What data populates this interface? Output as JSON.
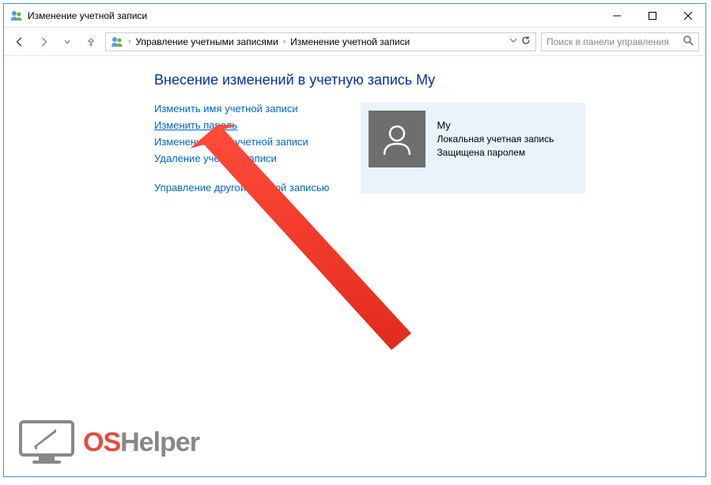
{
  "window": {
    "title": "Изменение учетной записи"
  },
  "breadcrumb": {
    "item1": "Управление учетными записями",
    "item2": "Изменение учетной записи"
  },
  "search": {
    "placeholder": "Поиск в панели управления"
  },
  "page": {
    "heading": "Внесение изменений в учетную запись My"
  },
  "links": {
    "rename": "Изменить имя учетной записи",
    "change_password": "Изменить пароль",
    "change_type": "Изменение типа учетной записи",
    "delete": "Удаление учетной записи",
    "manage_other": "Управление другой учетной записью"
  },
  "account": {
    "name": "My",
    "type": "Локальная учетная запись",
    "protection": "Защищена паролем"
  },
  "watermark": {
    "os": "OS",
    "helper": "Helper"
  }
}
